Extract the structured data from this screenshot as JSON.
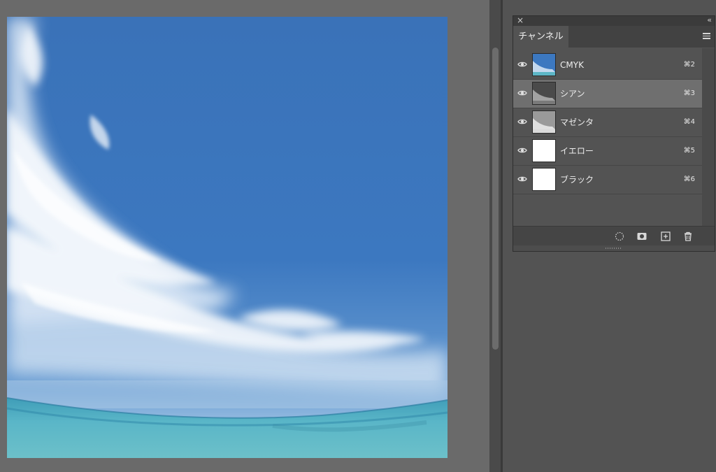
{
  "panel": {
    "close_icon": "×",
    "collapse_icon": "‹‹",
    "tab_label": "チャンネル",
    "menu_icon": "hamburger-menu-icon"
  },
  "channels": [
    {
      "name": "CMYK",
      "shortcut": "⌘2",
      "visible": true,
      "selected": false,
      "thumb": "sky-color"
    },
    {
      "name": "シアン",
      "shortcut": "⌘3",
      "visible": true,
      "selected": true,
      "thumb": "sky-gray-dark"
    },
    {
      "name": "マゼンタ",
      "shortcut": "⌘4",
      "visible": true,
      "selected": false,
      "thumb": "sky-gray-light"
    },
    {
      "name": "イエロー",
      "shortcut": "⌘5",
      "visible": true,
      "selected": false,
      "thumb": "white"
    },
    {
      "name": "ブラック",
      "shortcut": "⌘6",
      "visible": true,
      "selected": false,
      "thumb": "white"
    }
  ],
  "footer_icons": [
    "load-selection-icon",
    "save-selection-icon",
    "new-channel-icon",
    "trash-icon"
  ],
  "colors": {
    "workspace": "#6a6a6a",
    "panel": "#535353",
    "selected_row": "#6f6f6f",
    "sky": "#3a74bb",
    "sea": "#57b8c6"
  }
}
